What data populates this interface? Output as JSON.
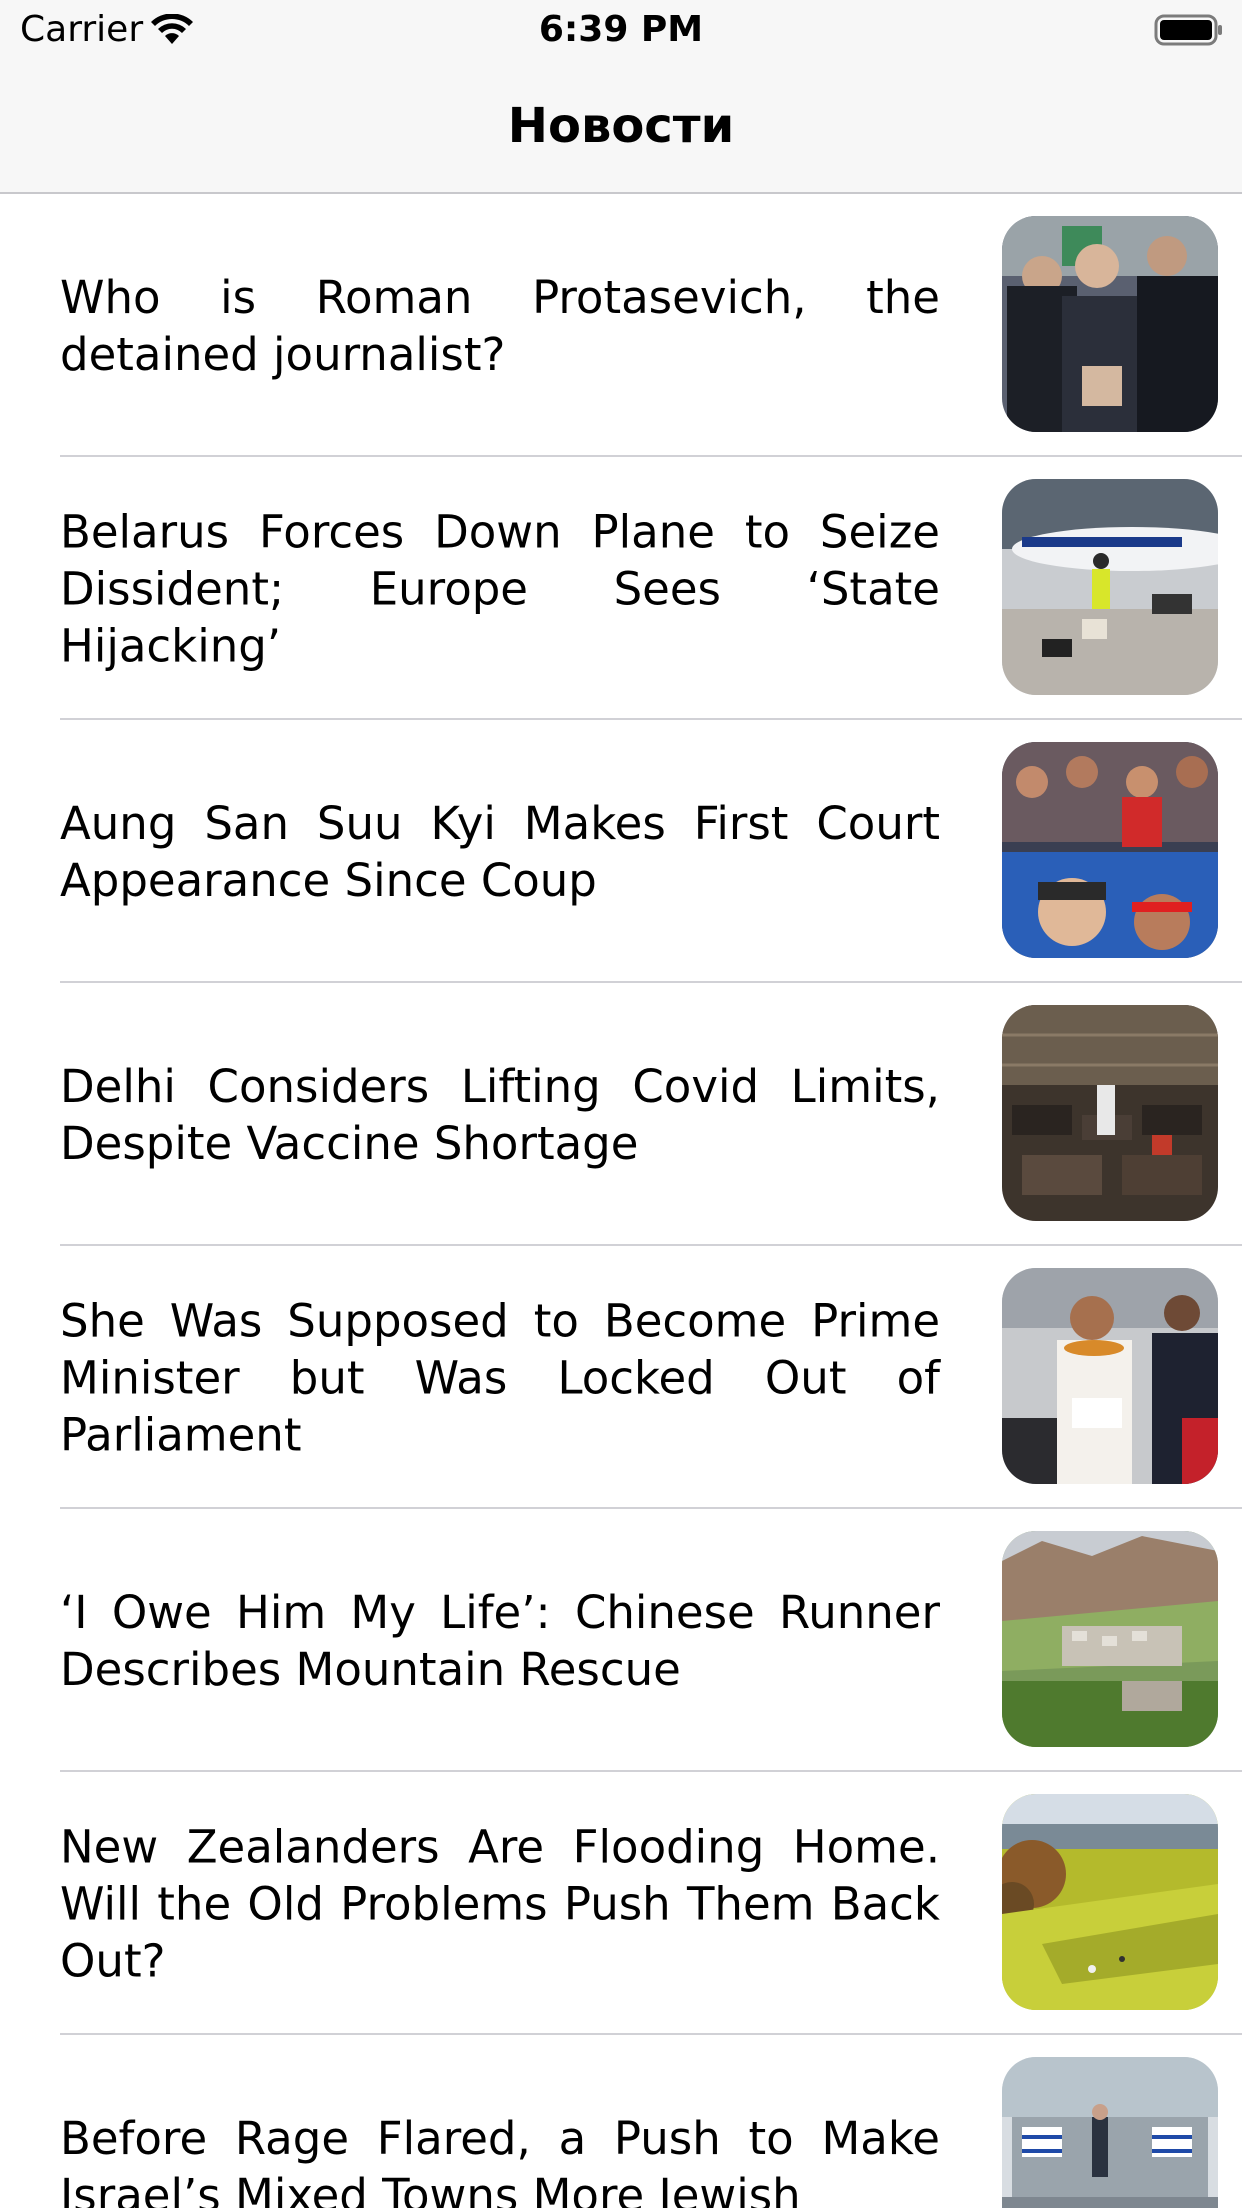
{
  "status_bar": {
    "carrier": "Carrier",
    "time": "6:39 PM",
    "wifi_icon": "wifi-icon",
    "battery_icon": "battery-icon"
  },
  "nav": {
    "title": "Новости"
  },
  "articles": [
    {
      "title": "Who is Roman Protasevich, the detained journalist?",
      "thumbnail": "protest-arrest-photo"
    },
    {
      "title": "Belarus Forces Down Plane to Seize Dissident; Europe Sees ‘State Hijacking’",
      "thumbnail": "ryanair-plane-photo"
    },
    {
      "title": "Aung San Suu Kyi Makes First Court Appearance Since Coup",
      "thumbnail": "myanmar-protest-photo"
    },
    {
      "title": "Delhi Considers Lifting Covid Limits, Despite Vaccine Shortage",
      "thumbnail": "covid-ward-photo"
    },
    {
      "title": "She Was Supposed to Become Prime Minister but Was Locked Out of Parliament",
      "thumbnail": "samoa-ceremony-photo"
    },
    {
      "title": "‘I Owe Him My Life’: Chinese Runner Describes Mountain Rescue",
      "thumbnail": "mountain-valley-photo"
    },
    {
      "title": "New Zealanders Are Flooding Home. Will the Old Problems Push Them Back Out?",
      "thumbnail": "park-hillside-photo"
    },
    {
      "title": "Before Rage Flared, a Push to Make Israel’s Mixed Towns More Jewish",
      "thumbnail": "israel-flags-photo"
    }
  ]
}
